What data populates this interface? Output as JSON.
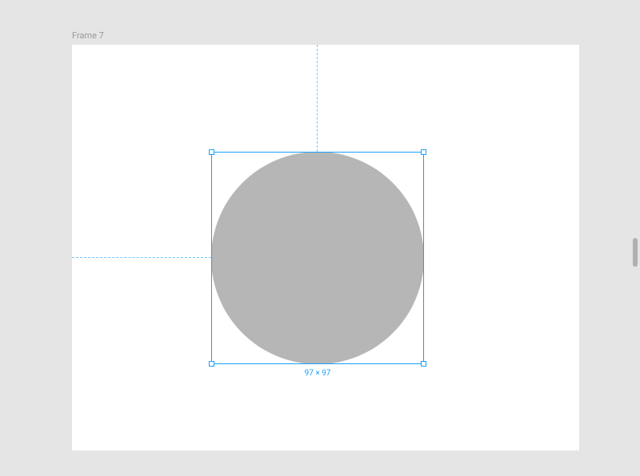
{
  "frame": {
    "label": "Frame 7"
  },
  "selection": {
    "dimension_label": "97 × 97",
    "shape": "Ellipse",
    "width": 97,
    "height": 97
  },
  "colors": {
    "shape_fill": "#b6b6b6",
    "selection_stroke": "#18a0fb",
    "canvas_bg": "#e5e5e5",
    "frame_bg": "#ffffff"
  }
}
